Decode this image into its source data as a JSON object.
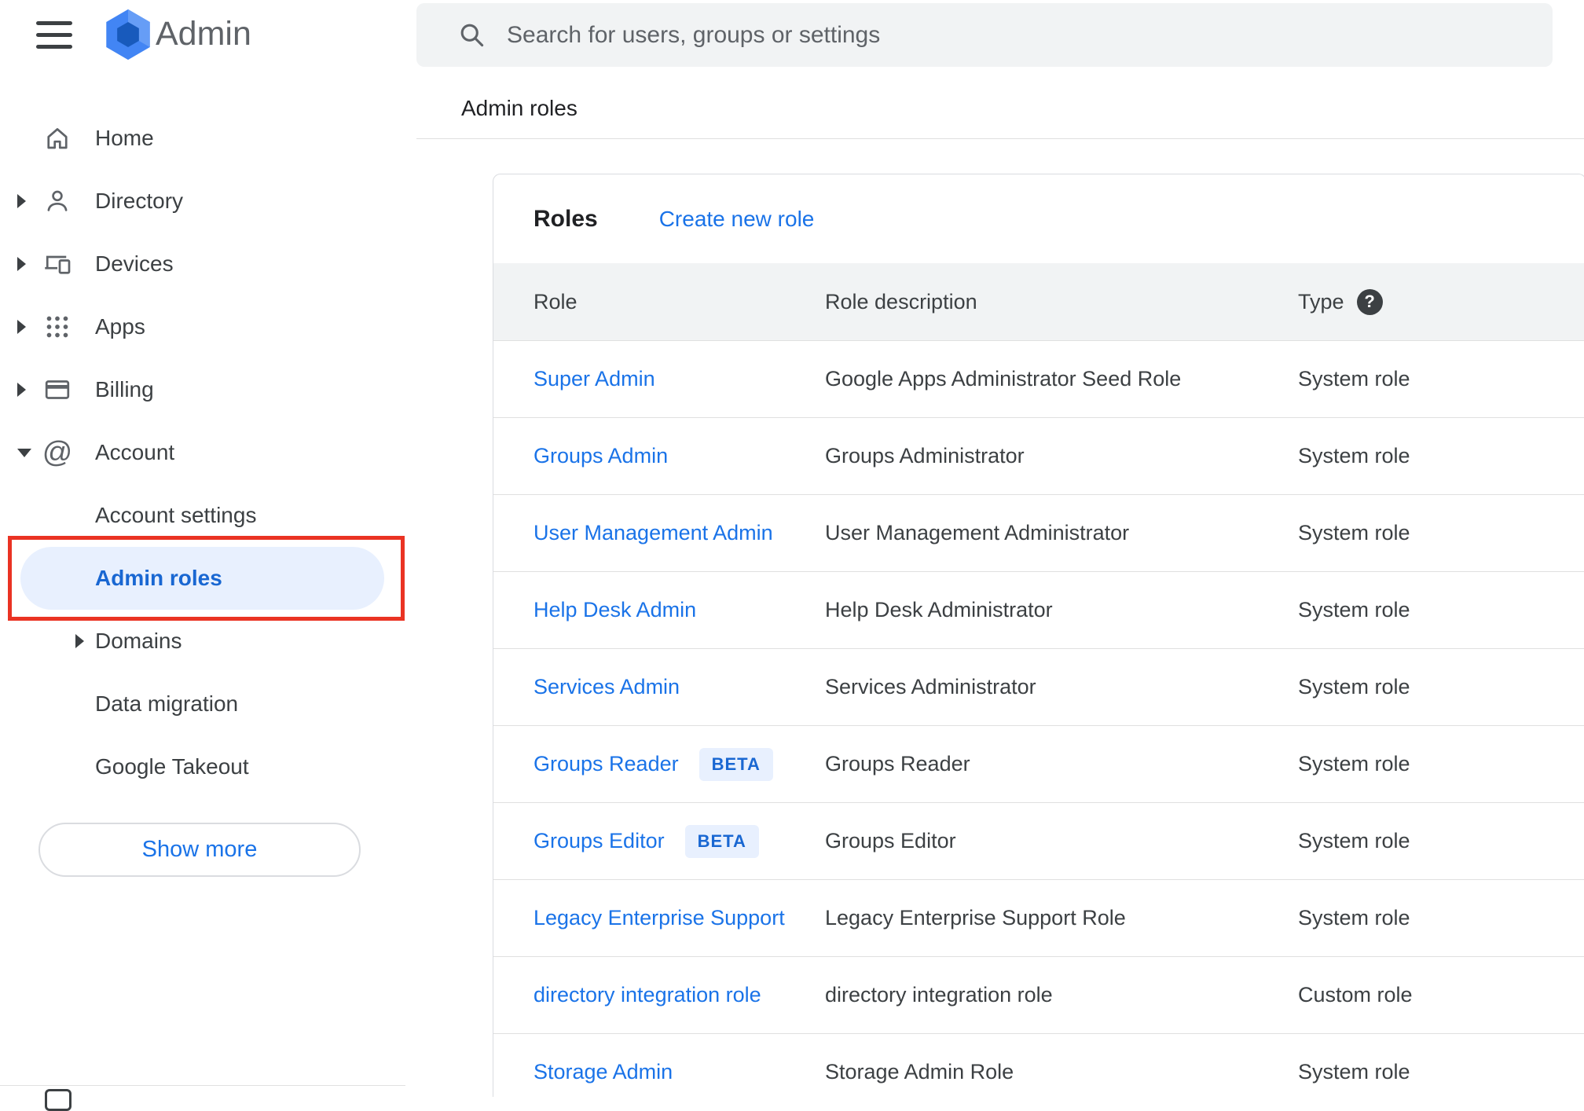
{
  "app": {
    "name": "Admin"
  },
  "topbar": {
    "search_placeholder": "Search for users, groups or settings"
  },
  "breadcrumb": {
    "title": "Admin roles"
  },
  "glyphs": {
    "help": "?",
    "at": "@"
  },
  "sidebar": {
    "items": [
      {
        "id": "home",
        "label": "Home",
        "icon": "home-icon",
        "chevron": "none"
      },
      {
        "id": "directory",
        "label": "Directory",
        "icon": "person-icon",
        "chevron": "right"
      },
      {
        "id": "devices",
        "label": "Devices",
        "icon": "devices-icon",
        "chevron": "right"
      },
      {
        "id": "apps",
        "label": "Apps",
        "icon": "apps-icon",
        "chevron": "right"
      },
      {
        "id": "billing",
        "label": "Billing",
        "icon": "billing-icon",
        "chevron": "right"
      },
      {
        "id": "account",
        "label": "Account",
        "icon": "at-icon",
        "chevron": "down"
      }
    ],
    "account_subitems": [
      {
        "id": "account-settings",
        "label": "Account settings",
        "selected": false,
        "chevron": "none"
      },
      {
        "id": "admin-roles",
        "label": "Admin roles",
        "selected": true,
        "chevron": "none"
      },
      {
        "id": "domains",
        "label": "Domains",
        "selected": false,
        "chevron": "right"
      },
      {
        "id": "data-migration",
        "label": "Data migration",
        "selected": false,
        "chevron": "none"
      },
      {
        "id": "google-takeout",
        "label": "Google Takeout",
        "selected": false,
        "chevron": "none"
      }
    ],
    "show_more_label": "Show more"
  },
  "roles": {
    "title": "Roles",
    "create_new_role_label": "Create new role",
    "columns": {
      "role": "Role",
      "description": "Role description",
      "type": "Type"
    },
    "beta_label": "BETA",
    "rows": [
      {
        "role": "Super Admin",
        "beta": false,
        "description": "Google Apps Administrator Seed Role",
        "type": "System role"
      },
      {
        "role": "Groups Admin",
        "beta": false,
        "description": "Groups Administrator",
        "type": "System role"
      },
      {
        "role": "User Management Admin",
        "beta": false,
        "description": "User Management Administrator",
        "type": "System role"
      },
      {
        "role": "Help Desk Admin",
        "beta": false,
        "description": "Help Desk Administrator",
        "type": "System role"
      },
      {
        "role": "Services Admin",
        "beta": false,
        "description": "Services Administrator",
        "type": "System role"
      },
      {
        "role": "Groups Reader",
        "beta": true,
        "description": "Groups Reader",
        "type": "System role"
      },
      {
        "role": "Groups Editor",
        "beta": true,
        "description": "Groups Editor",
        "type": "System role"
      },
      {
        "role": "Legacy Enterprise Support",
        "beta": false,
        "description": "Legacy Enterprise Support Role",
        "type": "System role"
      },
      {
        "role": "directory integration role",
        "beta": false,
        "description": "directory integration role",
        "type": "Custom role"
      },
      {
        "role": "Storage Admin",
        "beta": false,
        "description": "Storage Admin Role",
        "type": "System role"
      }
    ]
  },
  "annotation": {
    "color": "#ea3323"
  },
  "colors": {
    "link_blue": "#1a73e8",
    "selected_blue": "#1967d2",
    "selected_bg": "#e8f0fe",
    "header_bg": "#f1f3f4",
    "text_dark": "#202124",
    "text_gray": "#3c4043",
    "icon_gray": "#5f6368",
    "border": "#dadce0"
  }
}
